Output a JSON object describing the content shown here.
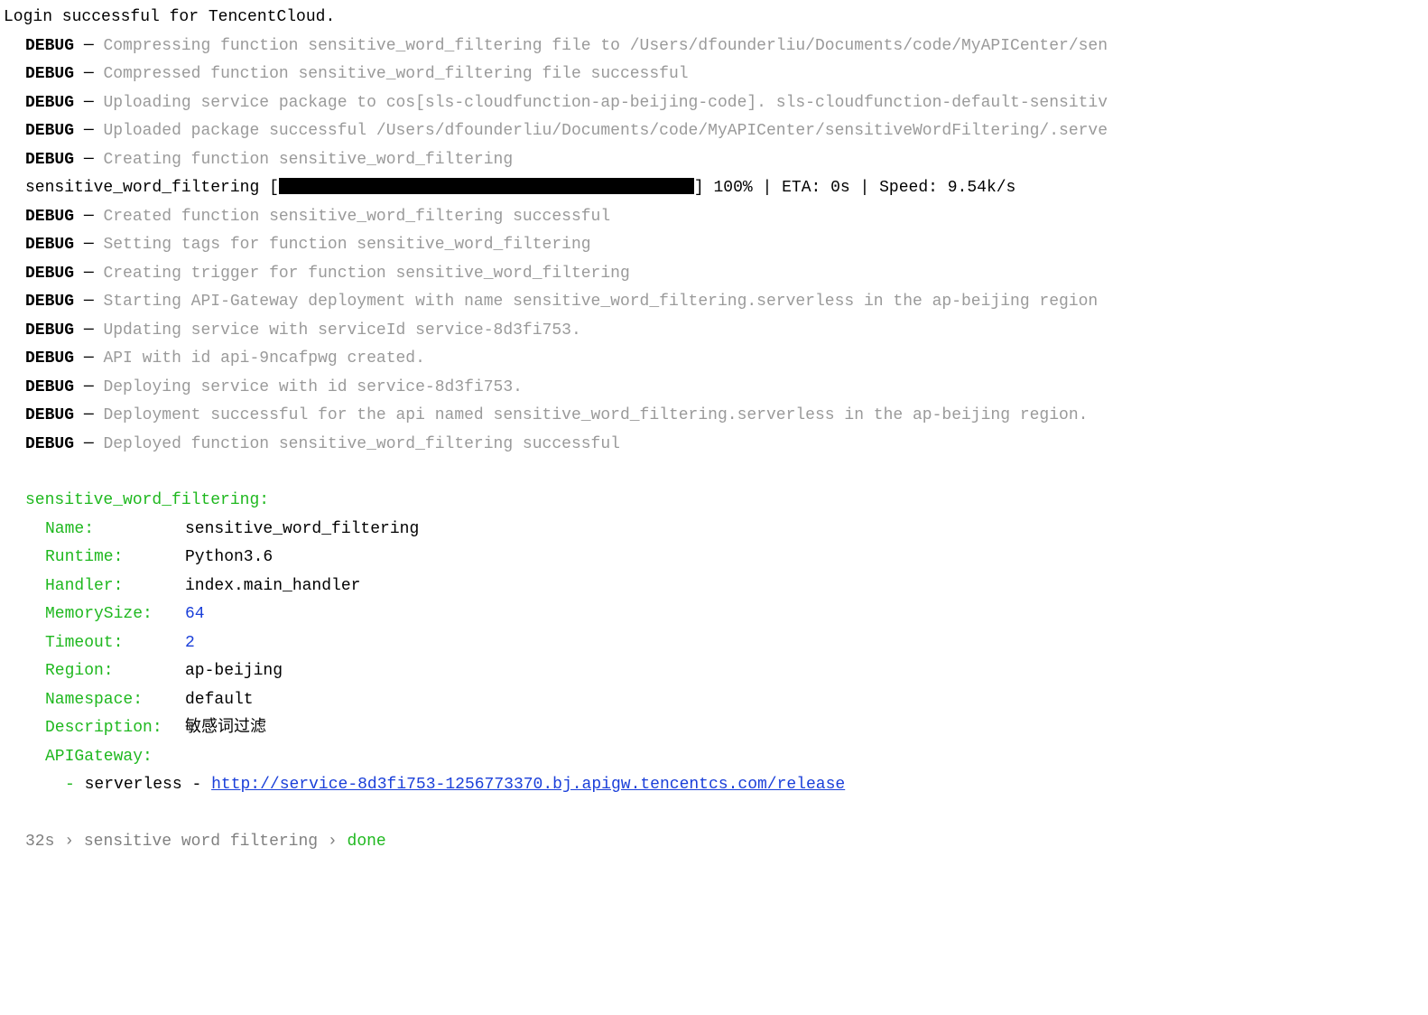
{
  "login": "Login successful for TencentCloud.",
  "debugLabel": "DEBUG",
  "dash": "─",
  "debug": [
    "Compressing function sensitive_word_filtering file to /Users/dfounderliu/Documents/code/MyAPICenter/sen",
    "Compressed function sensitive_word_filtering file successful",
    "Uploading service package to cos[sls-cloudfunction-ap-beijing-code]. sls-cloudfunction-default-sensitiv",
    "Uploaded package successful /Users/dfounderliu/Documents/code/MyAPICenter/sensitiveWordFiltering/.serve",
    "Creating function sensitive_word_filtering"
  ],
  "progress": {
    "name": "sensitive_word_filtering",
    "open": "[",
    "close": "]",
    "stats": " 100% | ETA: 0s | Speed: 9.54k/s"
  },
  "debug2": [
    "Created function sensitive_word_filtering successful",
    "Setting tags for function sensitive_word_filtering",
    "Creating trigger for function sensitive_word_filtering",
    "Starting API-Gateway deployment with name sensitive_word_filtering.serverless in the ap-beijing region",
    "Updating service with serviceId service-8d3fi753.",
    "API with id api-9ncafpwg created.",
    "Deploying service with id service-8d3fi753.",
    "Deployment successful for the api named sensitive_word_filtering.serverless in the ap-beijing region.",
    "Deployed function sensitive_word_filtering successful"
  ],
  "resultHeader": "sensitive_word_filtering:",
  "kv": {
    "nameKey": "Name:",
    "nameVal": "sensitive_word_filtering",
    "runtimeKey": "Runtime:",
    "runtimeVal": "Python3.6",
    "handlerKey": "Handler:",
    "handlerVal": "index.main_handler",
    "memKey": "MemorySize:",
    "memVal": "64",
    "timeoutKey": "Timeout:",
    "timeoutVal": "2",
    "regionKey": "Region:",
    "regionVal": "ap-beijing",
    "nsKey": "Namespace:",
    "nsVal": "default",
    "descKey": "Description:",
    "descVal": "敏感词过滤",
    "apigwKey": "APIGateway:"
  },
  "apigw": {
    "dash": "-",
    "label": "serverless",
    "dash2": "-",
    "url": "http://service-8d3fi753-1256773370.bj.apigw.tencentcs.com/release"
  },
  "footer": {
    "time": "32s",
    "sep": "›",
    "name": "sensitive word filtering",
    "done": "done"
  }
}
